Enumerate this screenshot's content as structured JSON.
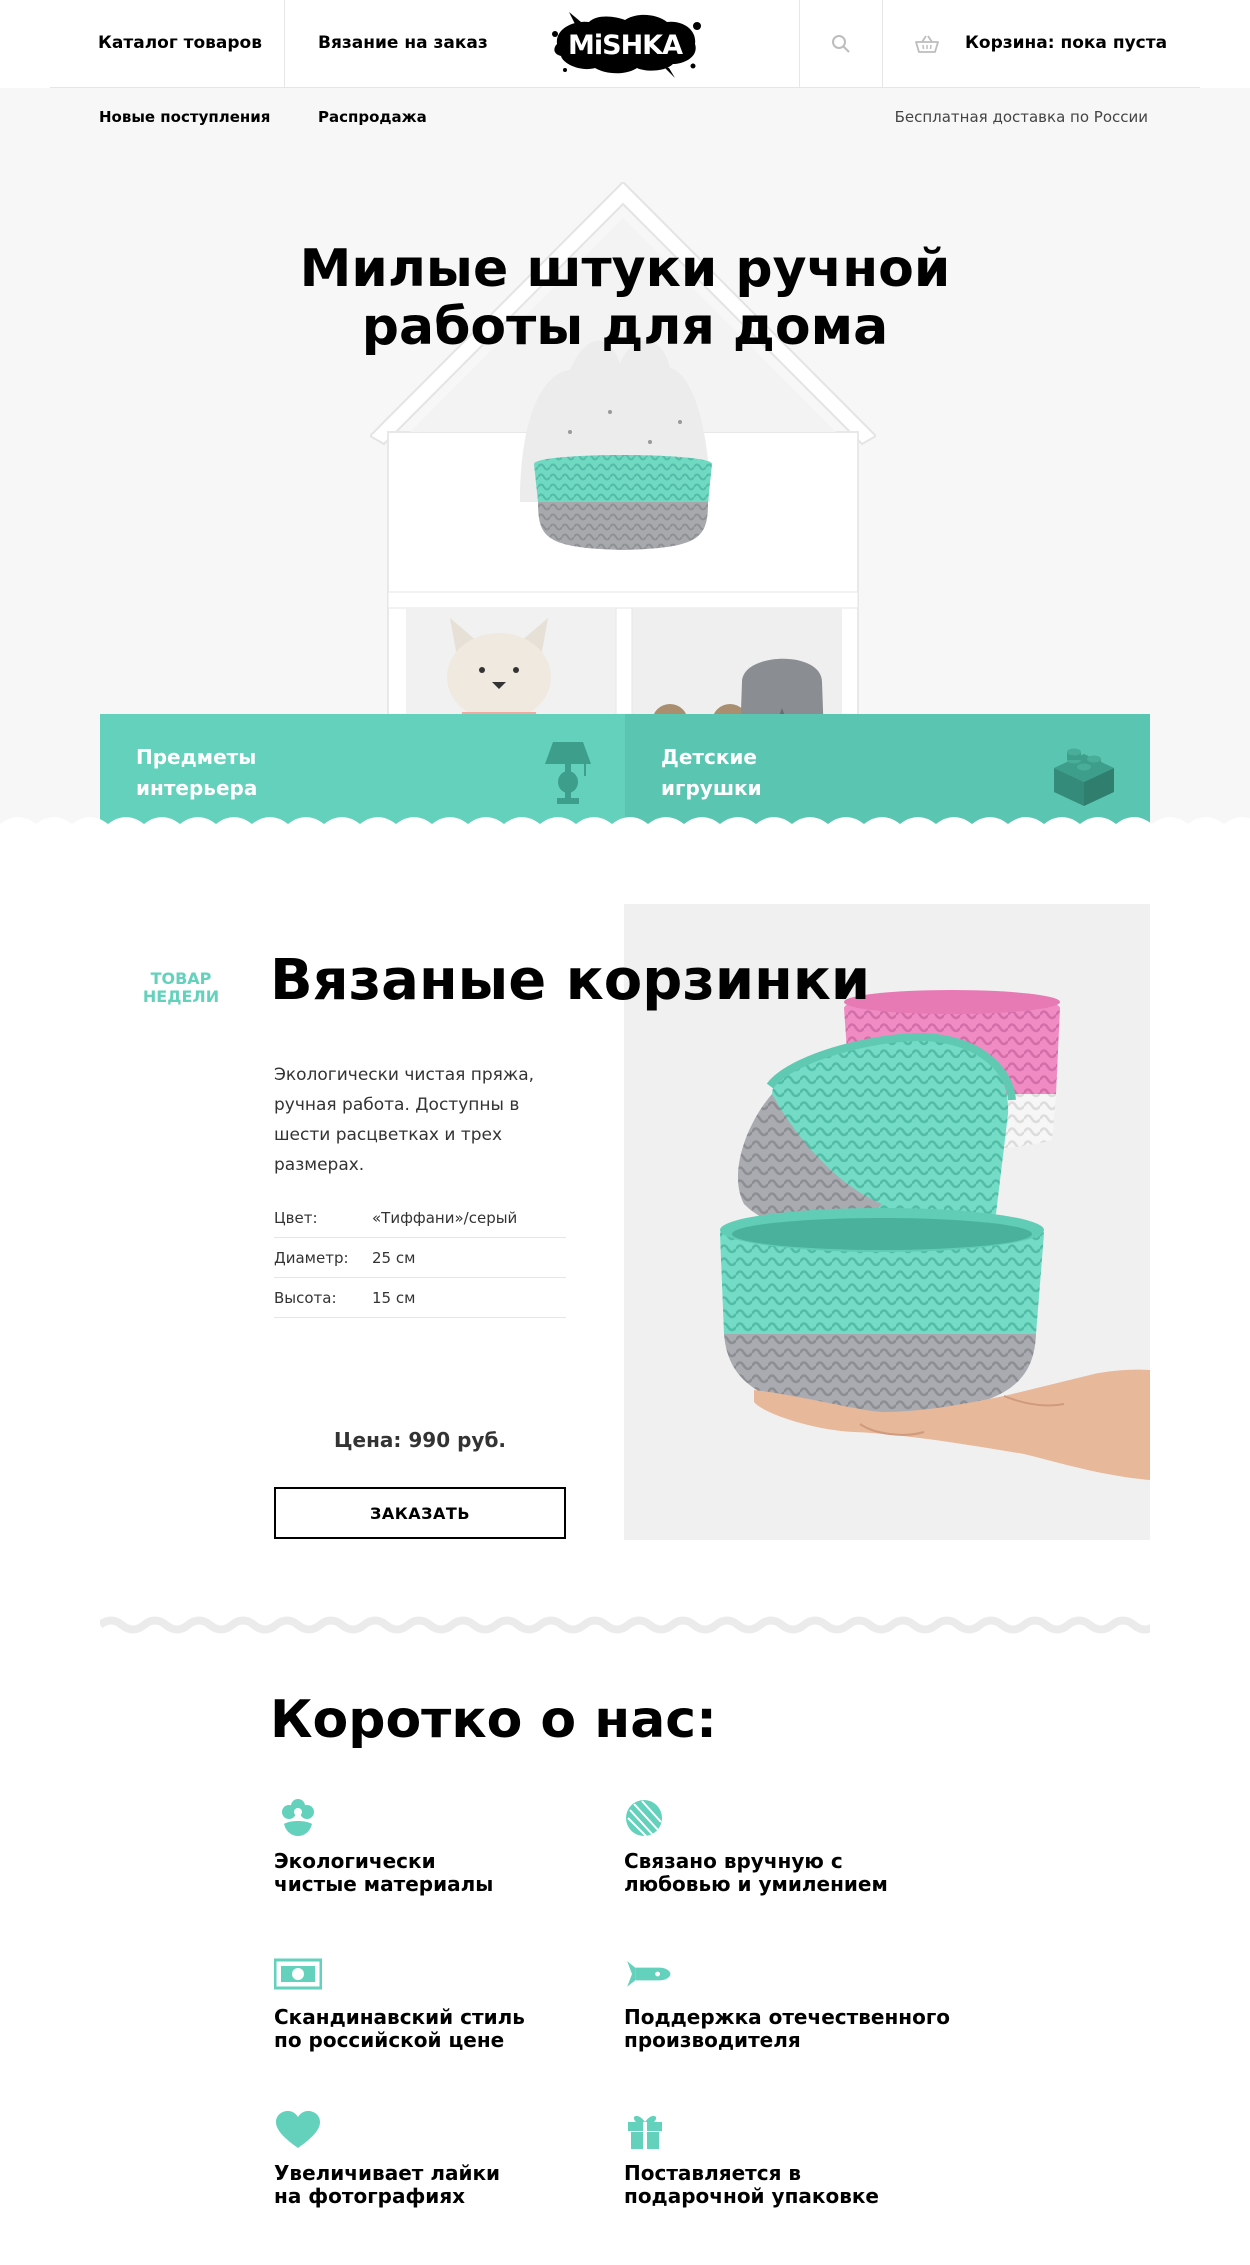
{
  "header": {
    "nav": [
      "Каталог товаров",
      "Вязание на заказ"
    ],
    "logo_text": "MiSHKA",
    "cart_label": "Корзина: пока пуста"
  },
  "subnav": {
    "links": [
      "Новые поступления",
      "Распродажа"
    ],
    "delivery": "Бесплатная доставка по России"
  },
  "hero": {
    "title_line1": "Милые штуки ручной",
    "title_line2": "работы для дома"
  },
  "categories": [
    {
      "line1": "Предметы",
      "line2": "интерьера",
      "icon": "lamp-icon"
    },
    {
      "line1": "Детские",
      "line2": "игрушки",
      "icon": "toy-brick-icon"
    }
  ],
  "product": {
    "badge_line1": "ТОВАР",
    "badge_line2": "НЕДЕЛИ",
    "title": "Вязаные корзинки",
    "description": "Экологически чистая пряжа, ручная работа. Доступны в шести расцветках и трех размерах.",
    "specs": [
      {
        "key": "Цвет:",
        "value": "«Тиффани»/серый"
      },
      {
        "key": "Диаметр:",
        "value": "25 см"
      },
      {
        "key": "Высота:",
        "value": "15 см"
      }
    ],
    "price": "Цена: 990 руб.",
    "order_label": "ЗАКАЗАТЬ"
  },
  "about": {
    "title": "Коротко о нас:",
    "features": [
      {
        "text": "Экологически\nчистые материалы",
        "icon": "flower-icon"
      },
      {
        "text": "Связано вручную с\nлюбовью и умилением",
        "icon": "yarn-ball-icon"
      },
      {
        "text": "Скандинавский стиль\nпо российской цене",
        "icon": "banknote-icon"
      },
      {
        "text": "Поддержка отечественного\nпроизводителя",
        "icon": "rocket-icon"
      },
      {
        "text": "Увеличивает лайки\nна фотографиях",
        "icon": "heart-icon"
      },
      {
        "text": "Поставляется в\nподарочной упаковке",
        "icon": "gift-icon"
      }
    ]
  },
  "colors": {
    "accent": "#63d1bb",
    "accent_dark": "#5ac5b1",
    "hero_bg": "#f7f7f7",
    "text": "#000000"
  }
}
